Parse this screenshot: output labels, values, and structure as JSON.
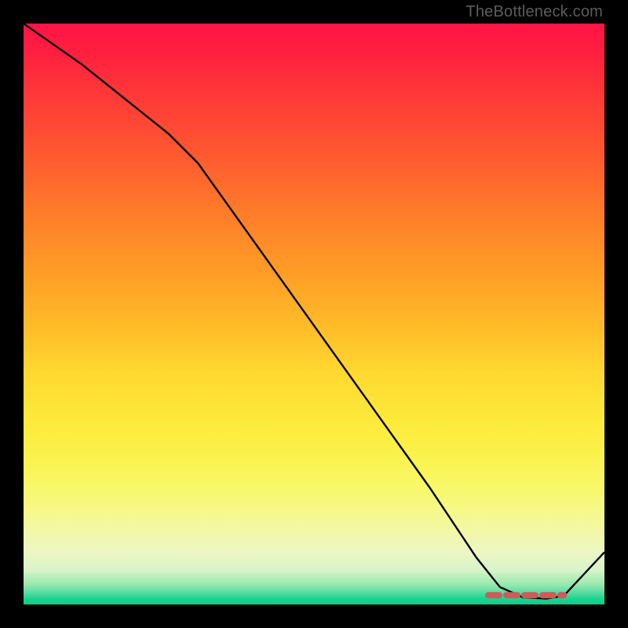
{
  "attribution": "TheBottleneck.com",
  "chart_data": {
    "type": "line",
    "title": "",
    "xlabel": "",
    "ylabel": "",
    "xlim": [
      0,
      100
    ],
    "ylim": [
      0,
      100
    ],
    "series": [
      {
        "name": "curve",
        "color": "#000000",
        "x": [
          0,
          10,
          20,
          25,
          30,
          40,
          50,
          60,
          70,
          78,
          82,
          86,
          90,
          93,
          100
        ],
        "y": [
          100,
          93,
          85,
          81,
          76,
          62,
          48,
          34,
          20,
          8,
          3,
          1.2,
          1,
          1.5,
          9
        ]
      }
    ],
    "flat_region": {
      "x_start": 80,
      "x_end": 93,
      "marker_color": "#cf5a5a"
    }
  },
  "colors": {
    "background_black": "#000000",
    "gradient_top": "#ff1446",
    "gradient_bottom": "#07cf8a",
    "attribution_text": "#5c5c5c",
    "flat_marker": "#cf5a5a"
  }
}
